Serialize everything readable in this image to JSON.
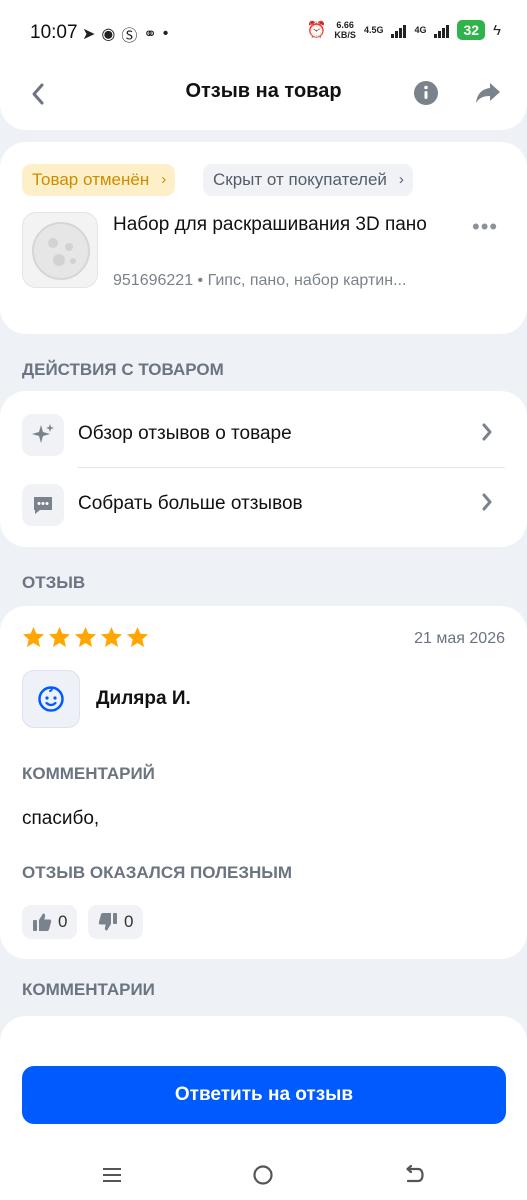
{
  "status_bar": {
    "time": "10:07",
    "net_speed_value": "6.66",
    "net_speed_unit": "KB/S",
    "network_1": "4.5G",
    "network_2": "4G",
    "battery": "32"
  },
  "header": {
    "title": "Отзыв на товар",
    "icons": [
      "back-arrow-icon",
      "info-icon",
      "share-icon"
    ]
  },
  "product": {
    "status_chip": "Товар отменён",
    "visibility_chip": "Скрыт от покупателей",
    "name": "Набор для раскрашивания 3D пано",
    "meta": "951696221 • Гипс, пано, набор картин..."
  },
  "actions": {
    "section_title": "ДЕЙСТВИЯ С ТОВАРОМ",
    "items": [
      {
        "label": "Обзор отзывов о товаре",
        "icon": "sparkles-icon"
      },
      {
        "label": "Собрать больше отзывов",
        "icon": "chat-bubble-icon"
      }
    ]
  },
  "review": {
    "section_title": "ОТЗЫВ",
    "rating": 5,
    "rating_max": 5,
    "date": "21 мая 2026",
    "author": "Диляра И.",
    "comment_title": "КОММЕНТАРИЙ",
    "comment": "спасибо,",
    "helpful_title": "ОТЗЫВ ОКАЗАЛСЯ ПОЛЕЗНЫМ",
    "likes": "0",
    "dislikes": "0"
  },
  "comments": {
    "section_title": "КОММЕНТАРИИ"
  },
  "reply_button": "Ответить на отзыв",
  "colors": {
    "accent": "#005bff",
    "star": "#ffa600",
    "warning_chip_text": "#d08a00",
    "battery": "#2fb34a"
  }
}
